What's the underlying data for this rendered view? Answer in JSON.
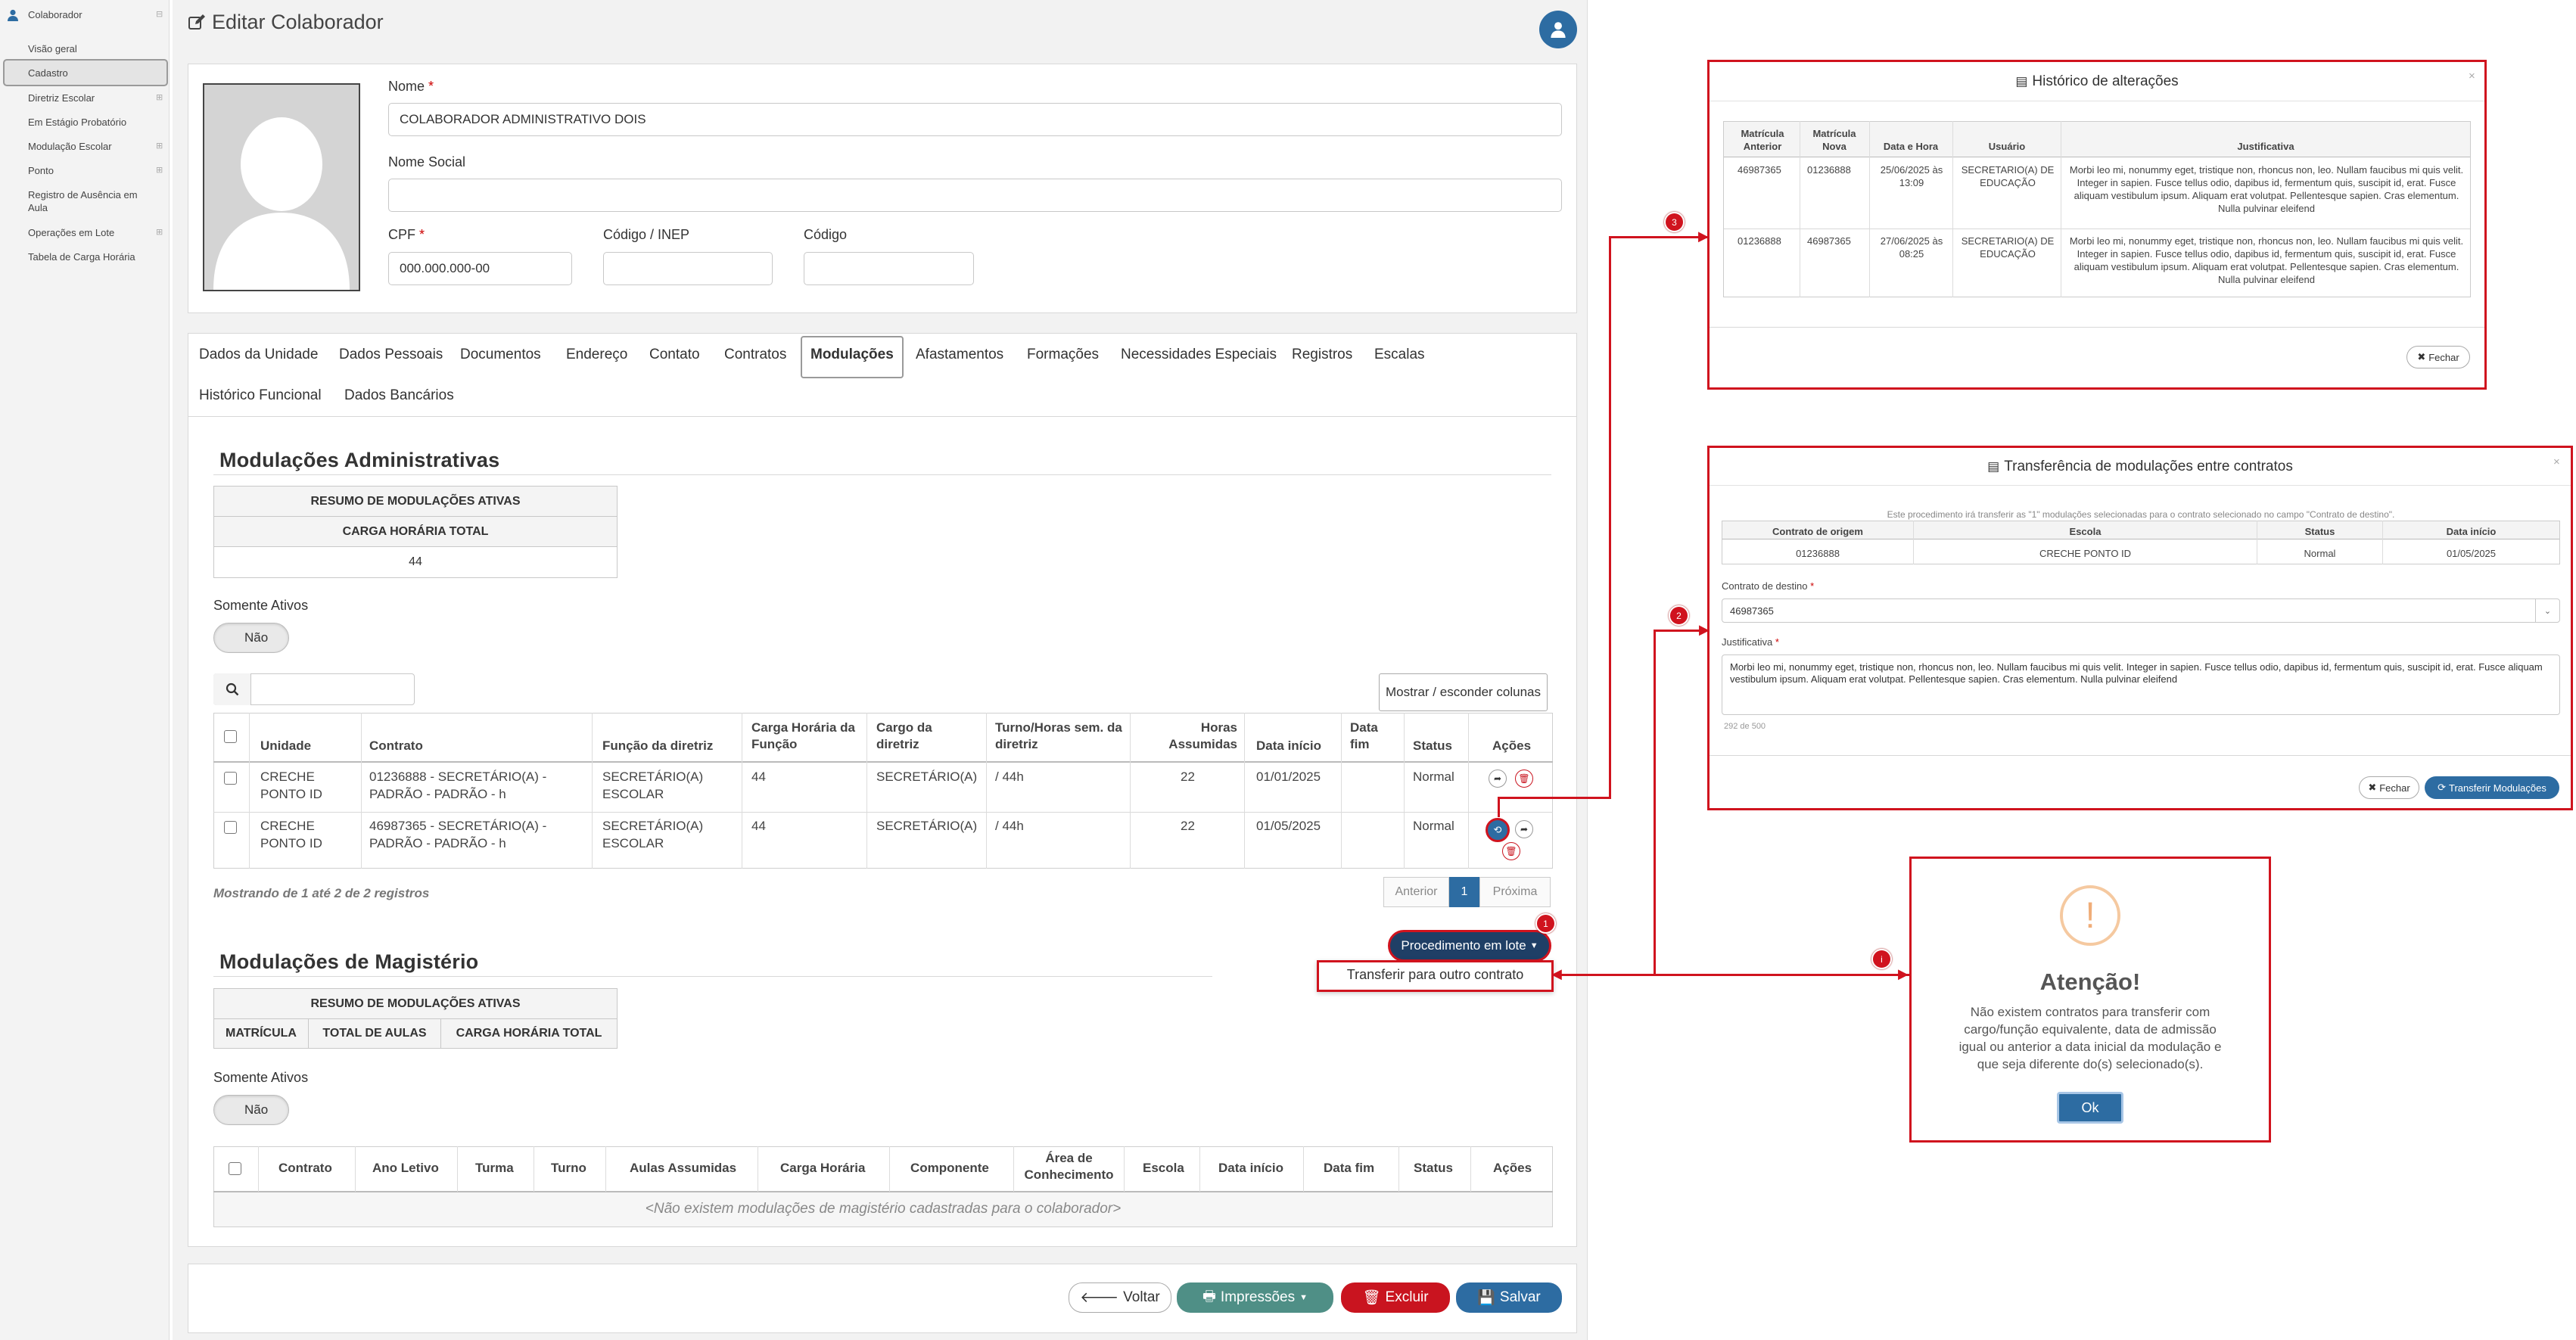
{
  "sidebar": {
    "module": "Colaborador",
    "items": [
      "Visão geral",
      "Cadastro",
      "Diretriz Escolar",
      "Em Estágio Probatório",
      "Modulação Escolar",
      "Ponto",
      "Registro de Ausência em Aula",
      "Operações em Lote",
      "Tabela de Carga Horária"
    ]
  },
  "page": {
    "title": "Editar Colaborador"
  },
  "form": {
    "nome_label": "Nome",
    "nome_value": "COLABORADOR ADMINISTRATIVO DOIS",
    "nome_social_label": "Nome Social",
    "nome_social_value": "",
    "cpf_label": "CPF",
    "cpf_value": "000.000.000-00",
    "inep_label": "Código / INEP",
    "inep_value": "",
    "codigo_label": "Código",
    "codigo_value": "",
    "required_mark": "*"
  },
  "tabs": [
    "Dados da Unidade",
    "Dados Pessoais",
    "Documentos",
    "Endereço",
    "Contato",
    "Contratos",
    "Modulações",
    "Afastamentos",
    "Formações",
    "Necessidades Especiais",
    "Registros",
    "Escalas",
    "Histórico Funcional",
    "Dados Bancários"
  ],
  "admin": {
    "title": "Modulações Administrativas",
    "summary_title": "RESUMO DE MODULAÇÕES ATIVAS",
    "summary_col": "CARGA HORÁRIA TOTAL",
    "summary_value": "44",
    "somente_ativos_label": "Somente Ativos",
    "toggle_value": "Não",
    "search_placeholder": "",
    "columns_button": "Mostrar / esconder colunas",
    "headers": [
      "Unidade",
      "Contrato",
      "Função da diretriz",
      "Carga Horária da Função",
      "Cargo da diretriz",
      "Turno/Horas sem. da diretriz",
      "Horas Assumidas",
      "Data início",
      "Data fim",
      "Status",
      "Ações"
    ],
    "rows": [
      {
        "unidade": "CRECHE PONTO ID",
        "contrato": "01236888 - SECRETÁRIO(A) - PADRÃO - PADRÃO - h",
        "funcao": "SECRETÁRIO(A) ESCOLAR",
        "ch_funcao": "44",
        "cargo": "SECRETÁRIO(A)",
        "turno": "/ 44h",
        "horas": "22",
        "inicio": "01/01/2025",
        "fim": "",
        "status": "Normal"
      },
      {
        "unidade": "CRECHE PONTO ID",
        "contrato": "46987365 - SECRETÁRIO(A) - PADRÃO - PADRÃO - h",
        "funcao": "SECRETÁRIO(A) ESCOLAR",
        "ch_funcao": "44",
        "cargo": "SECRETÁRIO(A)",
        "turno": "/ 44h",
        "horas": "22",
        "inicio": "01/05/2025",
        "fim": "",
        "status": "Normal"
      }
    ],
    "showing": "Mostrando de 1 até 2 de 2 registros",
    "pag_prev": "Anterior",
    "pag_current": "1",
    "pag_next": "Próxima",
    "lote_button": "Procedimento em lote",
    "lote_menu_item": "Transferir para outro contrato"
  },
  "mag": {
    "title": "Modulações de Magistério",
    "summary_title": "RESUMO DE MODULAÇÕES ATIVAS",
    "summary_cols": [
      "MATRÍCULA",
      "TOTAL DE AULAS",
      "CARGA HORÁRIA TOTAL"
    ],
    "somente_ativos_label": "Somente Ativos",
    "toggle_value": "Não",
    "headers": [
      "Contrato",
      "Ano Letivo",
      "Turma",
      "Turno",
      "Aulas Assumidas",
      "Carga Horária",
      "Componente",
      "Área de Conhecimento",
      "Escola",
      "Data início",
      "Data fim",
      "Status",
      "Ações"
    ],
    "empty": "<Não existem modulações de magistério cadastradas para o colaborador>"
  },
  "footer": {
    "voltar": "Voltar",
    "impressoes": "Impressões",
    "excluir": "Excluir",
    "salvar": "Salvar"
  },
  "badges": {
    "b1": "1",
    "b2": "2",
    "b3": "3",
    "bi": "i"
  },
  "historico": {
    "title": "Histórico de alterações",
    "headers": [
      "Matrícula Anterior",
      "Matrícula Nova",
      "Data e Hora",
      "Usuário",
      "Justificativa"
    ],
    "rows": [
      {
        "anterior": "46987365",
        "nova": "01236888",
        "data": "25/06/2025 às 13:09",
        "usuario": "SECRETARIO(A) DE EDUCAÇÃO",
        "just": "Morbi leo mi, nonummy eget, tristique non, rhoncus non, leo. Nullam faucibus mi quis velit. Integer in sapien. Fusce tellus odio, dapibus id, fermentum quis, suscipit id, erat. Fusce aliquam vestibulum ipsum. Aliquam erat volutpat. Pellentesque sapien. Cras elementum. Nulla pulvinar eleifend"
      },
      {
        "anterior": "01236888",
        "nova": "46987365",
        "data": "27/06/2025 às 08:25",
        "usuario": "SECRETARIO(A) DE EDUCAÇÃO",
        "just": "Morbi leo mi, nonummy eget, tristique non, rhoncus non, leo. Nullam faucibus mi quis velit. Integer in sapien. Fusce tellus odio, dapibus id, fermentum quis, suscipit id, erat. Fusce aliquam vestibulum ipsum. Aliquam erat volutpat. Pellentesque sapien. Cras elementum. Nulla pulvinar eleifend"
      }
    ],
    "close": "Fechar"
  },
  "transfer": {
    "title": "Transferência de modulações entre contratos",
    "info": "Este procedimento irá transferir as \"1\" modulações selecionadas para o contrato selecionado no campo \"Contrato de destino\".",
    "headers": [
      "Contrato de origem",
      "Escola",
      "Status",
      "Data início"
    ],
    "row": {
      "contrato": "01236888",
      "escola": "CRECHE PONTO ID",
      "status": "Normal",
      "inicio": "01/05/2025"
    },
    "destino_label": "Contrato de destino",
    "destino_value": "46987365",
    "just_label": "Justificativa",
    "just_value": "Morbi leo mi, nonummy eget, tristique non, rhoncus non, leo. Nullam faucibus mi quis velit. Integer in sapien. Fusce tellus odio, dapibus id, fermentum quis, suscipit id, erat. Fusce aliquam vestibulum ipsum. Aliquam erat volutpat. Pellentesque sapien. Cras elementum. Nulla pulvinar eleifend",
    "counter": "292 de 500",
    "close": "Fechar",
    "submit": "Transferir Modulações"
  },
  "alert": {
    "title": "Atenção!",
    "icon_glyph": "!",
    "message": "Não existem contratos para transferir com cargo/função equivalente, data de admissão igual ou anterior a data inicial da modulação e que seja diferente do(s) selecionado(s).",
    "ok": "Ok"
  },
  "colors": {
    "primary": "#2d6ca2",
    "danger": "#c9141f",
    "teal": "#4f8f86",
    "accent_red": "#d0131e"
  }
}
